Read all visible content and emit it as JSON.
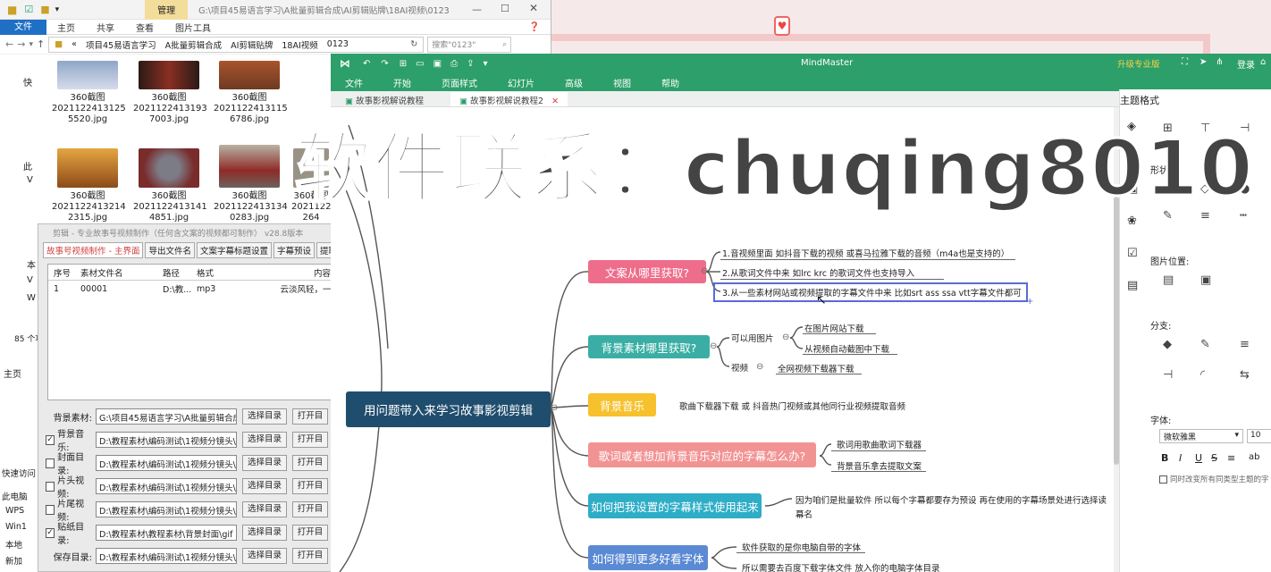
{
  "explorer": {
    "manage_tab": "管理",
    "title_path": "G:\\项目45易语言学习\\A批量剪辑合成\\AI剪辑贴牌\\18AI视频\\0123",
    "tabs": [
      "文件",
      "主页",
      "共享",
      "查看",
      "图片工具"
    ],
    "address_parts": [
      "«",
      "项目45易语言学习",
      "A批量剪辑合成",
      "AI剪辑贴牌",
      "18AI视频",
      "0123"
    ],
    "search_placeholder": "搜索\"0123\"",
    "thumbs": [
      {
        "name": "360截图",
        "file": "2021122413125",
        "file2": "5520.jpg"
      },
      {
        "name": "360截图",
        "file": "2021122413193",
        "file2": "7003.jpg"
      },
      {
        "name": "360截图",
        "file": "2021122413115",
        "file2": "6786.jpg"
      },
      {
        "name": "360截图",
        "file": "2021122413214",
        "file2": "2315.jpg"
      },
      {
        "name": "360截图",
        "file": "2021122413141",
        "file2": "4851.jpg"
      },
      {
        "name": "360截图",
        "file": "2021122413134",
        "file2": "0283.jpg"
      },
      {
        "name": "360截图",
        "file": "2021122",
        "file2": "264"
      }
    ],
    "nav_items": [
      "快",
      "此",
      "V",
      "本",
      "V",
      "W"
    ],
    "item_count": "85 个项",
    "colors": {
      "accent": "#1f6fc5",
      "manage": "#f3dd9a"
    }
  },
  "leftnav": {
    "home": "主页",
    "items": [
      "快速访问",
      "此电脑",
      "WPS",
      "Win1",
      "本地",
      "新加"
    ]
  },
  "tool": {
    "title": "剪辑 - 专业故事号视频制作（任何含文案的视频都可制作）  v28.8版本",
    "tabs": [
      "故事号视频制作 - 主界面",
      "导出文件名",
      "文案字幕标题设置",
      "字幕预设",
      "提取文案"
    ],
    "table": {
      "headers": [
        "序号",
        "素材文件名",
        "路径",
        "格式",
        "内容"
      ],
      "row": [
        "1",
        "00001",
        "D:\\教...",
        "mp3",
        "云淡风轻，一轮"
      ]
    },
    "fields": [
      {
        "label": "背景素材:",
        "checked": null,
        "value": "G:\\项目45易语言学习\\A批量剪辑合成\\",
        "btn": "选择目录",
        "btn2": "打开目"
      },
      {
        "label": "背景音乐:",
        "checked": true,
        "value": "D:\\教程素材\\编码测试\\1视频分镜头\\测",
        "btn": "选择目录",
        "btn2": "打开目"
      },
      {
        "label": "封面目录:",
        "checked": false,
        "value": "D:\\教程素材\\编码测试\\1视频分镜头\\00",
        "btn": "选择目录",
        "btn2": "打开目"
      },
      {
        "label": "片头视频:",
        "checked": false,
        "value": "D:\\教程素材\\编码测试\\1视频分镜头\\00",
        "btn": "选择目录",
        "btn2": "打开目"
      },
      {
        "label": "片尾视频:",
        "checked": false,
        "value": "D:\\教程素材\\编码测试\\1视频分镜头\\00",
        "btn": "选择目录",
        "btn2": "打开目"
      },
      {
        "label": "贴纸目录:",
        "checked": true,
        "value": "D:\\教程素材\\教程素材\\背景封面\\gif",
        "btn": "选择目录",
        "btn2": "打开目"
      },
      {
        "label": "保存目录:",
        "checked": null,
        "value": "D:\\教程素材\\编码测试\\1视频分镜头\\测",
        "btn": "选择目录",
        "btn2": "打开目"
      }
    ]
  },
  "mindmaster": {
    "app_title": "MindMaster",
    "upgrade": "升级专业版",
    "login": "登录",
    "menu": [
      "文件",
      "开始",
      "页面样式",
      "幻灯片",
      "高级",
      "视图",
      "帮助"
    ],
    "doc_tabs": [
      "故事影视解说教程",
      "故事影视解说教程2"
    ],
    "central": "用问题带入来学习故事影视剪辑",
    "branches": [
      {
        "label": "文案从哪里获取?",
        "color": "#ee6d8a"
      },
      {
        "label": "背景素材哪里获取?",
        "color": "#3aaea4"
      },
      {
        "label": "背景音乐",
        "color": "#f6c12c"
      },
      {
        "label": "歌词或者想加背景音乐对应的字幕怎么办?",
        "color": "#f29393"
      },
      {
        "label": "如何把我设置的字幕样式使用起来",
        "color": "#2eadc7"
      },
      {
        "label": "如何得到更多好看字体",
        "color": "#5b8ad4"
      }
    ],
    "leaves": {
      "b1": [
        "1.音视频里面 如抖音下载的视频 或喜马拉雅下载的音频（m4a也是支持的）",
        "2.从歌词文件中来 如lrc krc 的歌词文件也支持导入",
        "3.从一些素材网站或视频提取的字幕文件中来 比如srt ass ssa vtt字幕文件都可"
      ],
      "b2_sub": [
        "可以用图片",
        "视频"
      ],
      "b2_img": [
        "在图片网站下载",
        "从视频自动截图中下载"
      ],
      "b2_vid": [
        "全网视频下载器下载"
      ],
      "b3": [
        "歌曲下载器下载 或 抖音热门视频或其他同行业视频提取音频"
      ],
      "b4": [
        "歌词用歌曲歌词下载器",
        "背景音乐拿去提取文案"
      ],
      "b5": [
        "因为咱们是批量软件 所以每个字幕都要存为预设 再在使用的字幕场景处进行选择读",
        "幕名"
      ],
      "b6": [
        "软件获取的是你电脑自带的字体",
        "所以需要去百度下载字体文件 放入你的电脑字体目录"
      ]
    },
    "pane": {
      "title": "主题格式",
      "shape": "形状:",
      "image_pos": "图片位置:",
      "branch": "分支:",
      "font": "字体:",
      "font_name": "微软雅黑",
      "font_size": "10",
      "apply_all": "同时改变所有同类型主题的字"
    },
    "watermark": "软件联系：chuqing8010"
  }
}
